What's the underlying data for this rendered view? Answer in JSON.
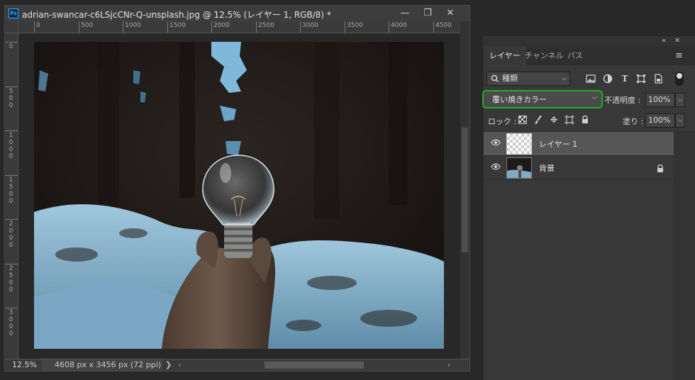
{
  "document": {
    "app_badge": "Ps",
    "title": "adrian-swancar-c6LSjcCNr-Q-unsplash.jpg @ 12.5% (レイヤー 1, RGB/8) *",
    "window_buttons": {
      "minimize": "—",
      "restore": "❐",
      "close": "✕"
    },
    "ruler_h": [
      "0",
      "500",
      "1000",
      "1500",
      "2000",
      "2500",
      "3000",
      "3500",
      "4000",
      "4500"
    ],
    "ruler_v": [
      "0",
      "500",
      "1000",
      "1500",
      "2000",
      "2500",
      "3000"
    ],
    "status": {
      "zoom": "12.5%",
      "info": "4608 px x 3456 px (72 ppi)",
      "arrow": "❯",
      "left_arrow": "‹",
      "right_arrow": "›"
    }
  },
  "layers_panel": {
    "collapse_icon": "«",
    "menu_icon": "≡",
    "tabs": [
      "レイヤー",
      "チャンネル",
      "パス"
    ],
    "filter": {
      "label": "種類",
      "icon": "search-icon"
    },
    "filter_icons": [
      "image-filter-icon",
      "adjustment-filter-icon",
      "type-filter-icon",
      "shape-filter-icon",
      "smart-object-filter-icon"
    ],
    "blend_mode": "覆い焼きカラー",
    "opacity_label": "不透明度 :",
    "opacity_value": "100%",
    "lock_label": "ロック :",
    "lock_icons": [
      "lock-transparent-pixels-icon",
      "lock-image-pixels-icon",
      "lock-position-icon",
      "lock-artboard-icon",
      "lock-all-icon"
    ],
    "fill_label": "塗り :",
    "fill_value": "100%",
    "layers": [
      {
        "name": "レイヤー 1",
        "selected": true,
        "locked": false
      },
      {
        "name": "背景",
        "selected": false,
        "locked": true
      }
    ]
  },
  "colors": {
    "accent_highlight": "#20b020",
    "ps_blue": "#31a8ff",
    "selected_row": "#565656"
  }
}
